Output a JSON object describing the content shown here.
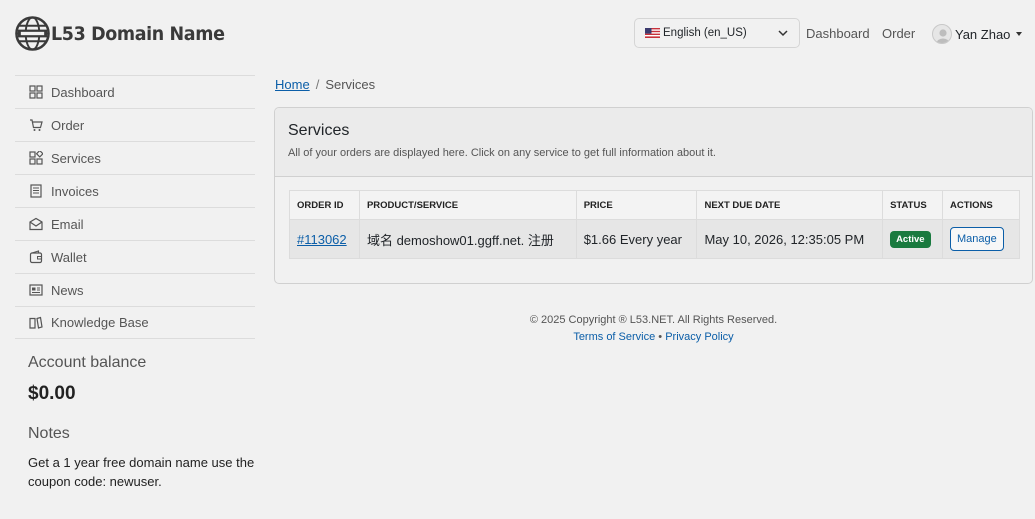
{
  "header": {
    "brand": "L53 Domain Name",
    "language": "English (en_US)",
    "nav": [
      "Dashboard",
      "Order"
    ],
    "user_name": "Yan Zhao"
  },
  "sidebar": {
    "items": [
      {
        "label": "Dashboard",
        "icon": "dashboard-icon"
      },
      {
        "label": "Order",
        "icon": "cart-icon"
      },
      {
        "label": "Services",
        "icon": "services-icon"
      },
      {
        "label": "Invoices",
        "icon": "invoice-icon"
      },
      {
        "label": "Email",
        "icon": "email-icon"
      },
      {
        "label": "Wallet",
        "icon": "wallet-icon"
      },
      {
        "label": "News",
        "icon": "news-icon"
      },
      {
        "label": "Knowledge Base",
        "icon": "book-icon"
      }
    ],
    "balance_label": "Account balance",
    "balance_value": "$0.00",
    "notes_label": "Notes",
    "notes_text": "Get a 1 year free domain name use the coupon code: newuser."
  },
  "breadcrumb": {
    "home": "Home",
    "separator": "/",
    "current": "Services"
  },
  "services": {
    "title": "Services",
    "subtitle": "All of your orders are displayed here. Click on any service to get full information about it.",
    "columns": [
      "ORDER ID",
      "PRODUCT/SERVICE",
      "PRICE",
      "NEXT DUE DATE",
      "STATUS",
      "ACTIONS"
    ],
    "rows": [
      {
        "order_id": "#113062",
        "product": "域名 demoshow01.ggff.net. 注册",
        "price": "$1.66 Every year",
        "next_due": "May 10, 2026, 12:35:05 PM",
        "status": "Active",
        "action": "Manage"
      }
    ]
  },
  "footer": {
    "copyright": "© 2025 Copyright ® L53.NET. All Rights Reserved.",
    "terms": "Terms of Service",
    "bullet": "•",
    "privacy": "Privacy Policy"
  },
  "colors": {
    "background": "#f1f1f1",
    "link": "#0b5ea8",
    "status_active": "#1a7a3f"
  }
}
